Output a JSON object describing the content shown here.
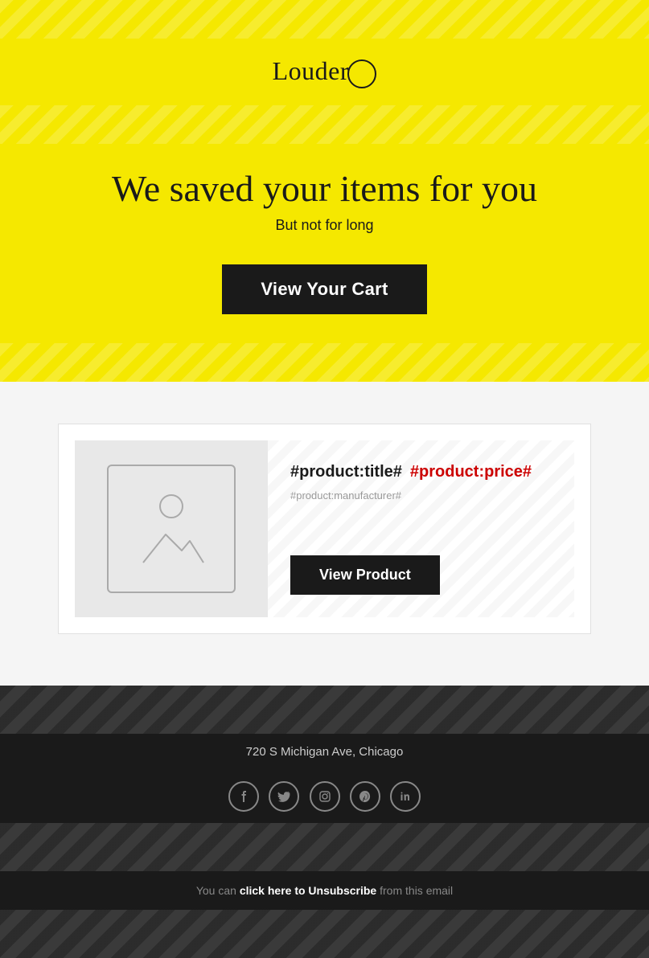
{
  "header": {
    "logo_text": "Louder",
    "headline": "We saved your items for you",
    "subheadline": "But not for long",
    "cta_label": "View Your Cart"
  },
  "product": {
    "title": "#product:title#",
    "price": "#product:price#",
    "manufacturer": "#product:manufacturer#",
    "cta_label": "View Product",
    "image_alt": "Product image placeholder"
  },
  "footer": {
    "address": "720 S Michigan Ave, Chicago",
    "unsubscribe_prefix": "You can ",
    "unsubscribe_link": "click here to Unsubscribe",
    "unsubscribe_suffix": " from this email",
    "social": {
      "facebook": "f",
      "twitter": "t",
      "instagram": "in",
      "pinterest": "p",
      "linkedin": "in"
    }
  }
}
